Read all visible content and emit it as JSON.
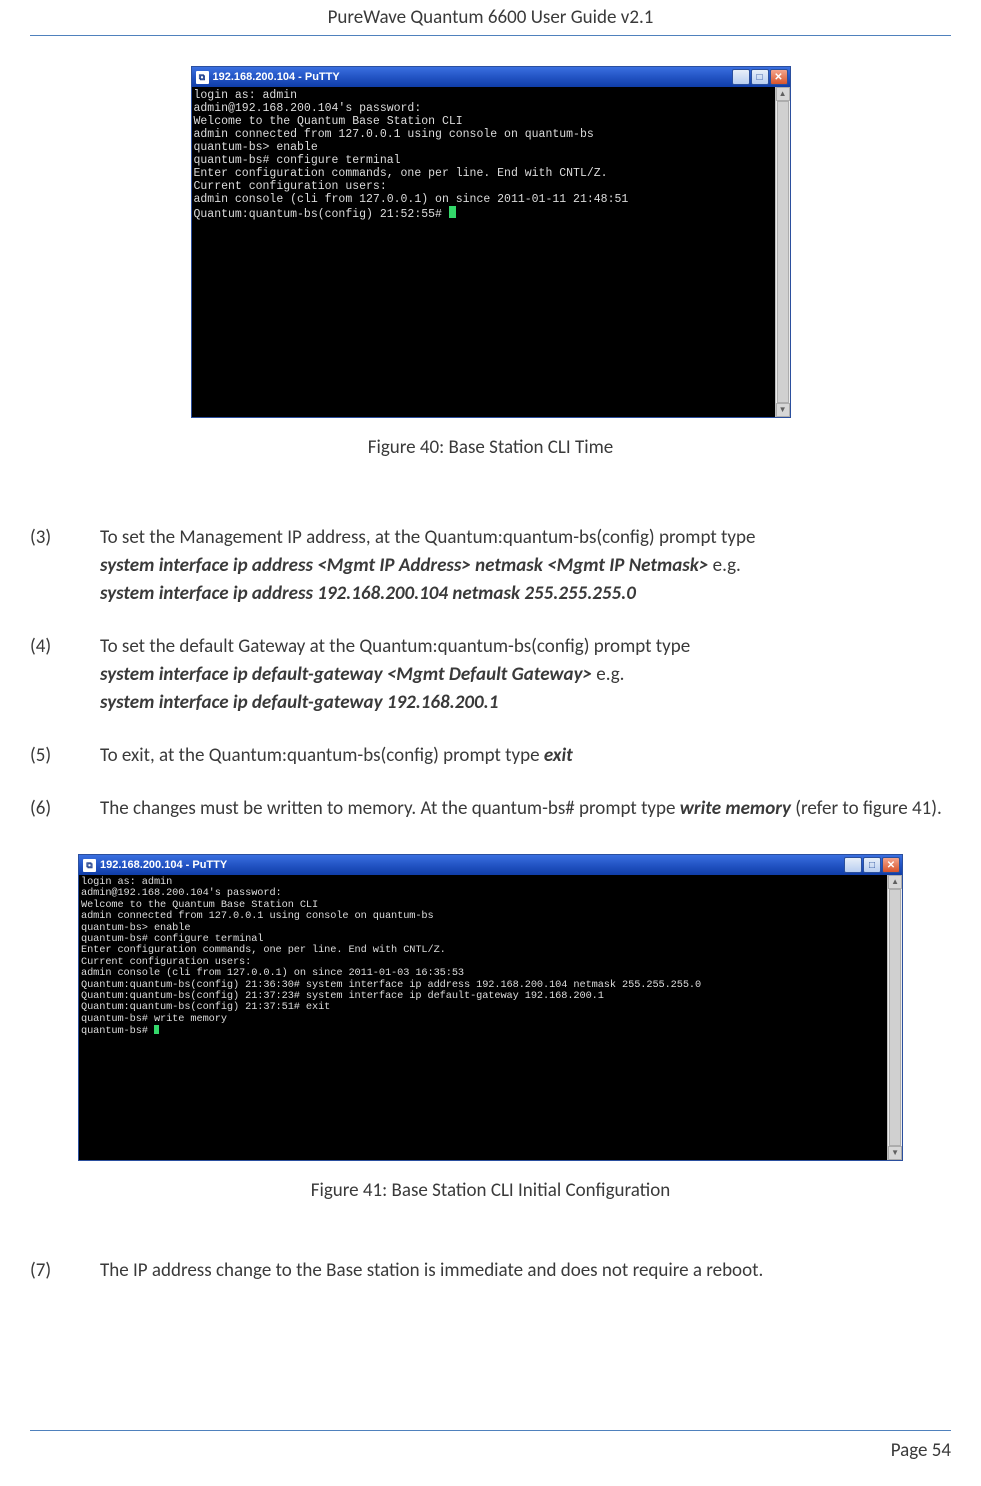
{
  "header": {
    "title": "PureWave Quantum 6600 User Guide v2.1"
  },
  "footer": {
    "page_label": "Page 54"
  },
  "figure40": {
    "caption": "Figure 40: Base Station CLI Time",
    "putty": {
      "title": "192.168.200.104 - PuTTY",
      "icon_glyph": "⧉",
      "terminal_text": "login as: admin\nadmin@192.168.200.104's password:\nWelcome to the Quantum Base Station CLI\nadmin connected from 127.0.0.1 using console on quantum-bs\nquantum-bs> enable\nquantum-bs# configure terminal\nEnter configuration commands, one per line. End with CNTL/Z.\nCurrent configuration users:\nadmin console (cli from 127.0.0.1) on since 2011-01-11 21:48:51\nQuantum:quantum-bs(config) 21:52:55# "
    }
  },
  "figure41": {
    "caption": "Figure 41: Base Station CLI Initial Configuration",
    "putty": {
      "title": "192.168.200.104 - PuTTY",
      "icon_glyph": "⧉",
      "terminal_text": "login as: admin\nadmin@192.168.200.104's password:\nWelcome to the Quantum Base Station CLI\nadmin connected from 127.0.0.1 using console on quantum-bs\nquantum-bs> enable\nquantum-bs# configure terminal\nEnter configuration commands, one per line. End with CNTL/Z.\nCurrent configuration users:\nadmin console (cli from 127.0.0.1) on since 2011-01-03 16:35:53\nQuantum:quantum-bs(config) 21:36:30# system interface ip address 192.168.200.104 netmask 255.255.255.0\nQuantum:quantum-bs(config) 21:37:23# system interface ip default-gateway 192.168.200.1\nQuantum:quantum-bs(config) 21:37:51# exit\nquantum-bs# write memory\nquantum-bs# "
    }
  },
  "steps": {
    "s3": {
      "num": "(3)",
      "t1": "To set the Management IP address, at the Quantum:quantum-bs(config) prompt type",
      "cmd_template": "system interface ip address <Mgmt IP Address> netmask <Mgmt IP Netmask>",
      "eg": " e.g.",
      "cmd_example": "system interface ip address 192.168.200.104 netmask 255.255.255.0"
    },
    "s4": {
      "num": "(4)",
      "t1": "To set the default Gateway at the Quantum:quantum-bs(config) prompt type",
      "cmd_template": "system interface ip default-gateway <Mgmt Default Gateway>",
      "eg": " e.g.",
      "cmd_example": "system interface ip default-gateway 192.168.200.1"
    },
    "s5": {
      "num": "(5)",
      "t1": "To exit, at the Quantum:quantum-bs(config) prompt type ",
      "cmd": "exit"
    },
    "s6": {
      "num": "(6)",
      "t1": "The changes must be written to memory. At the quantum-bs# prompt type ",
      "cmd": "write memory",
      "t2": " (refer to figure 41)."
    },
    "s7": {
      "num": "(7)",
      "t1": "The IP address change to the Base station is immediate and does not require a reboot."
    }
  }
}
